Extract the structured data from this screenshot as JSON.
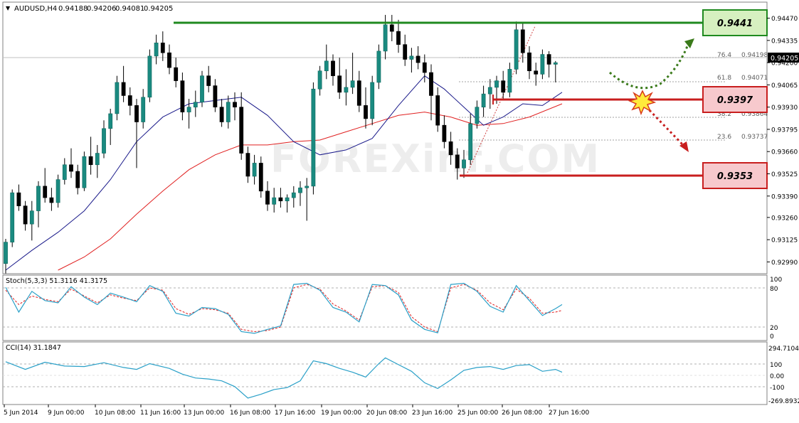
{
  "header": {
    "symbol_label": "AUDUSD,H4",
    "ohlc": [
      "0.94188",
      "0.94206",
      "0.94081",
      "0.94205"
    ]
  },
  "price_axis": {
    "ticks": [
      "0.94470",
      "0.94335",
      "0.94200",
      "0.94065",
      "0.93930",
      "0.93795",
      "0.93660",
      "0.93525",
      "0.93390",
      "0.93260",
      "0.93125",
      "0.92990"
    ],
    "current_price": "0.94205"
  },
  "time_axis": {
    "labels": [
      "5 Jun 2014",
      "9 Jun 00:00",
      "10 Jun 08:00",
      "11 Jun 16:00",
      "13 Jun 00:00",
      "16 Jun 08:00",
      "17 Jun 16:00",
      "19 Jun 00:00",
      "20 Jun 08:00",
      "23 Jun 16:00",
      "25 Jun 00:00",
      "26 Jun 08:00",
      "27 Jun 16:00"
    ]
  },
  "levels": [
    {
      "name": "resistance",
      "value": "0.9441",
      "color": "#1f8a1f",
      "fill": "#d6f0c0"
    },
    {
      "name": "pivot",
      "value": "0.9397",
      "color": "#c81e1e",
      "fill": "#f7c9cd"
    },
    {
      "name": "support",
      "value": "0.9353",
      "color": "#c81e1e",
      "fill": "#f7c9cd"
    }
  ],
  "fibonacci": [
    {
      "pct": "76.4",
      "price": "0.94198"
    },
    {
      "pct": "61.8",
      "price": "0.94071"
    },
    {
      "pct": "38.2",
      "price": "0.93864"
    },
    {
      "pct": "23.6",
      "price": "0.93737"
    }
  ],
  "watermark": "FOREXinf.COM",
  "stoch": {
    "label": "Stoch(5,3,3) 51.3116 41.3175",
    "ticks": [
      "100",
      "80",
      "20",
      "0"
    ]
  },
  "cci": {
    "label": "CCI(14) 31.1847",
    "ticks": [
      "294.7104",
      "100",
      "0.00",
      "-100",
      "-269.8932"
    ]
  },
  "chart_data": {
    "type": "candlestick",
    "symbol": "AUDUSD",
    "timeframe": "H4",
    "ylim": [
      0.9294,
      0.9452
    ],
    "candles": [
      [
        0.9298,
        0.9313,
        0.9292,
        0.9311
      ],
      [
        0.9311,
        0.9343,
        0.9308,
        0.9341
      ],
      [
        0.9341,
        0.9346,
        0.933,
        0.9333
      ],
      [
        0.9333,
        0.9336,
        0.9318,
        0.9322
      ],
      [
        0.9322,
        0.9336,
        0.9312,
        0.933
      ],
      [
        0.933,
        0.9348,
        0.932,
        0.9345
      ],
      [
        0.9345,
        0.9356,
        0.9335,
        0.9338
      ],
      [
        0.9338,
        0.9344,
        0.933,
        0.9335
      ],
      [
        0.9335,
        0.9352,
        0.9332,
        0.9349
      ],
      [
        0.9349,
        0.9362,
        0.9346,
        0.9358
      ],
      [
        0.9358,
        0.9368,
        0.935,
        0.9354
      ],
      [
        0.9354,
        0.9358,
        0.934,
        0.9344
      ],
      [
        0.9344,
        0.9366,
        0.9342,
        0.9363
      ],
      [
        0.9363,
        0.9375,
        0.9352,
        0.9358
      ],
      [
        0.9358,
        0.937,
        0.935,
        0.9365
      ],
      [
        0.9365,
        0.9385,
        0.9362,
        0.938
      ],
      [
        0.938,
        0.9392,
        0.937,
        0.9389
      ],
      [
        0.9389,
        0.9412,
        0.9385,
        0.9408
      ],
      [
        0.9408,
        0.9418,
        0.9396,
        0.94
      ],
      [
        0.94,
        0.9405,
        0.9388,
        0.9394
      ],
      [
        0.9394,
        0.9398,
        0.9356,
        0.9384
      ],
      [
        0.9384,
        0.9404,
        0.938,
        0.9399
      ],
      [
        0.9399,
        0.9428,
        0.9396,
        0.9424
      ],
      [
        0.9424,
        0.9437,
        0.9419,
        0.9432
      ],
      [
        0.9432,
        0.9439,
        0.9421,
        0.9426
      ],
      [
        0.9426,
        0.9431,
        0.9413,
        0.9417
      ],
      [
        0.9417,
        0.9423,
        0.9405,
        0.9409
      ],
      [
        0.9409,
        0.9414,
        0.9385,
        0.939
      ],
      [
        0.939,
        0.9398,
        0.938,
        0.9393
      ],
      [
        0.9393,
        0.9403,
        0.9387,
        0.9396
      ],
      [
        0.9396,
        0.9415,
        0.9393,
        0.9412
      ],
      [
        0.9412,
        0.9418,
        0.9402,
        0.9406
      ],
      [
        0.9406,
        0.941,
        0.939,
        0.9393
      ],
      [
        0.9393,
        0.9398,
        0.9381,
        0.9384
      ],
      [
        0.9384,
        0.94,
        0.938,
        0.9396
      ],
      [
        0.9396,
        0.9402,
        0.9385,
        0.9393
      ],
      [
        0.9393,
        0.9402,
        0.9361,
        0.9365
      ],
      [
        0.9365,
        0.9369,
        0.9347,
        0.9351
      ],
      [
        0.9351,
        0.9364,
        0.9346,
        0.9359
      ],
      [
        0.9359,
        0.9363,
        0.9338,
        0.9342
      ],
      [
        0.9342,
        0.9348,
        0.933,
        0.9334
      ],
      [
        0.9334,
        0.9344,
        0.9329,
        0.9338
      ],
      [
        0.9338,
        0.9344,
        0.9332,
        0.9336
      ],
      [
        0.9336,
        0.934,
        0.9329,
        0.9338
      ],
      [
        0.9338,
        0.9345,
        0.9332,
        0.9341
      ],
      [
        0.9341,
        0.9348,
        0.9333,
        0.9344
      ],
      [
        0.9344,
        0.935,
        0.9324,
        0.9345
      ],
      [
        0.9345,
        0.9408,
        0.934,
        0.9404
      ],
      [
        0.9404,
        0.9418,
        0.94,
        0.9415
      ],
      [
        0.9415,
        0.9431,
        0.941,
        0.9421
      ],
      [
        0.9421,
        0.9425,
        0.9406,
        0.9412
      ],
      [
        0.9412,
        0.9423,
        0.9398,
        0.9402
      ],
      [
        0.9402,
        0.9416,
        0.9394,
        0.9405
      ],
      [
        0.9405,
        0.9426,
        0.9401,
        0.9409
      ],
      [
        0.9409,
        0.9415,
        0.939,
        0.9394
      ],
      [
        0.9394,
        0.9405,
        0.938,
        0.9386
      ],
      [
        0.9386,
        0.9412,
        0.9382,
        0.9408
      ],
      [
        0.9408,
        0.9431,
        0.9404,
        0.9427
      ],
      [
        0.9427,
        0.9449,
        0.9422,
        0.9443
      ],
      [
        0.9443,
        0.9449,
        0.9433,
        0.9439
      ],
      [
        0.9439,
        0.9446,
        0.9426,
        0.9431
      ],
      [
        0.9431,
        0.9437,
        0.9418,
        0.9422
      ],
      [
        0.9422,
        0.9429,
        0.9414,
        0.9424
      ],
      [
        0.9424,
        0.943,
        0.9416,
        0.942
      ],
      [
        0.942,
        0.9425,
        0.9408,
        0.9414
      ],
      [
        0.9414,
        0.9419,
        0.9385,
        0.94
      ],
      [
        0.94,
        0.9405,
        0.9378,
        0.9382
      ],
      [
        0.9382,
        0.9388,
        0.9368,
        0.9372
      ],
      [
        0.9372,
        0.9378,
        0.9358,
        0.9364
      ],
      [
        0.9364,
        0.9368,
        0.9349,
        0.9356
      ],
      [
        0.9356,
        0.9367,
        0.935,
        0.9361
      ],
      [
        0.9361,
        0.9389,
        0.9358,
        0.9383
      ],
      [
        0.9383,
        0.9397,
        0.938,
        0.9393
      ],
      [
        0.9393,
        0.9406,
        0.9387,
        0.9401
      ],
      [
        0.9401,
        0.941,
        0.9392,
        0.9405
      ],
      [
        0.9405,
        0.9412,
        0.9395,
        0.9409
      ],
      [
        0.9409,
        0.9415,
        0.9398,
        0.9402
      ],
      [
        0.9402,
        0.942,
        0.9399,
        0.9416
      ],
      [
        0.9416,
        0.9445,
        0.9413,
        0.944
      ],
      [
        0.944,
        0.9444,
        0.942,
        0.9426
      ],
      [
        0.9426,
        0.943,
        0.941,
        0.9415
      ],
      [
        0.9415,
        0.942,
        0.9406,
        0.9413
      ],
      [
        0.9413,
        0.9428,
        0.941,
        0.9425
      ],
      [
        0.9425,
        0.9427,
        0.9411,
        0.9419
      ],
      [
        0.9419,
        0.9421,
        0.9408,
        0.942
      ]
    ],
    "sma_fast": [
      [
        0,
        0.9294
      ],
      [
        4,
        0.9306
      ],
      [
        8,
        0.9317
      ],
      [
        12,
        0.933
      ],
      [
        16,
        0.9349
      ],
      [
        20,
        0.9372
      ],
      [
        24,
        0.9387
      ],
      [
        28,
        0.9395
      ],
      [
        32,
        0.9397
      ],
      [
        36,
        0.9399
      ],
      [
        40,
        0.9388
      ],
      [
        44,
        0.9372
      ],
      [
        48,
        0.9364
      ],
      [
        52,
        0.9367
      ],
      [
        56,
        0.9374
      ],
      [
        60,
        0.9394
      ],
      [
        64,
        0.9412
      ],
      [
        67,
        0.9404
      ],
      [
        70,
        0.9393
      ],
      [
        73,
        0.9382
      ],
      [
        76,
        0.9387
      ],
      [
        79,
        0.9395
      ],
      [
        82,
        0.9394
      ],
      [
        85,
        0.9402
      ]
    ],
    "sma_slow": [
      [
        8,
        0.9294
      ],
      [
        12,
        0.9302
      ],
      [
        16,
        0.9313
      ],
      [
        20,
        0.9328
      ],
      [
        24,
        0.9342
      ],
      [
        28,
        0.9355
      ],
      [
        32,
        0.9364
      ],
      [
        36,
        0.937
      ],
      [
        40,
        0.937
      ],
      [
        44,
        0.9372
      ],
      [
        48,
        0.9373
      ],
      [
        52,
        0.9378
      ],
      [
        56,
        0.9383
      ],
      [
        60,
        0.9388
      ],
      [
        64,
        0.939
      ],
      [
        68,
        0.9387
      ],
      [
        72,
        0.9382
      ],
      [
        76,
        0.9383
      ],
      [
        80,
        0.9387
      ],
      [
        85,
        0.9395
      ]
    ],
    "stoch_main": [
      [
        0,
        85
      ],
      [
        2,
        42
      ],
      [
        4,
        78
      ],
      [
        6,
        62
      ],
      [
        8,
        58
      ],
      [
        10,
        86
      ],
      [
        12,
        68
      ],
      [
        14,
        55
      ],
      [
        16,
        75
      ],
      [
        18,
        68
      ],
      [
        20,
        60
      ],
      [
        22,
        88
      ],
      [
        24,
        78
      ],
      [
        26,
        40
      ],
      [
        28,
        35
      ],
      [
        30,
        50
      ],
      [
        32,
        48
      ],
      [
        34,
        38
      ],
      [
        36,
        8
      ],
      [
        38,
        5
      ],
      [
        40,
        12
      ],
      [
        42,
        18
      ],
      [
        44,
        90
      ],
      [
        46,
        92
      ],
      [
        48,
        80
      ],
      [
        50,
        50
      ],
      [
        52,
        42
      ],
      [
        54,
        25
      ],
      [
        56,
        90
      ],
      [
        58,
        88
      ],
      [
        60,
        72
      ],
      [
        62,
        28
      ],
      [
        64,
        12
      ],
      [
        66,
        6
      ],
      [
        68,
        90
      ],
      [
        70,
        92
      ],
      [
        72,
        78
      ],
      [
        74,
        52
      ],
      [
        76,
        42
      ],
      [
        78,
        88
      ],
      [
        80,
        62
      ],
      [
        82,
        36
      ],
      [
        84,
        48
      ],
      [
        85,
        55
      ]
    ],
    "stoch_signal": [
      [
        0,
        80
      ],
      [
        2,
        55
      ],
      [
        4,
        70
      ],
      [
        6,
        64
      ],
      [
        8,
        60
      ],
      [
        10,
        82
      ],
      [
        12,
        70
      ],
      [
        14,
        58
      ],
      [
        16,
        72
      ],
      [
        18,
        66
      ],
      [
        20,
        62
      ],
      [
        22,
        84
      ],
      [
        24,
        80
      ],
      [
        26,
        48
      ],
      [
        28,
        38
      ],
      [
        30,
        48
      ],
      [
        32,
        46
      ],
      [
        34,
        40
      ],
      [
        36,
        12
      ],
      [
        38,
        8
      ],
      [
        40,
        10
      ],
      [
        42,
        16
      ],
      [
        44,
        84
      ],
      [
        46,
        90
      ],
      [
        48,
        82
      ],
      [
        50,
        56
      ],
      [
        52,
        44
      ],
      [
        54,
        28
      ],
      [
        56,
        86
      ],
      [
        58,
        88
      ],
      [
        60,
        76
      ],
      [
        62,
        34
      ],
      [
        64,
        16
      ],
      [
        66,
        8
      ],
      [
        68,
        84
      ],
      [
        70,
        90
      ],
      [
        72,
        80
      ],
      [
        74,
        58
      ],
      [
        76,
        46
      ],
      [
        78,
        82
      ],
      [
        80,
        66
      ],
      [
        82,
        40
      ],
      [
        84,
        42
      ],
      [
        85,
        45
      ]
    ],
    "cci": [
      [
        0,
        140
      ],
      [
        3,
        60
      ],
      [
        6,
        135
      ],
      [
        9,
        95
      ],
      [
        12,
        90
      ],
      [
        15,
        130
      ],
      [
        18,
        80
      ],
      [
        20,
        60
      ],
      [
        22,
        120
      ],
      [
        25,
        70
      ],
      [
        27,
        10
      ],
      [
        29,
        -30
      ],
      [
        31,
        -40
      ],
      [
        33,
        -60
      ],
      [
        35,
        -120
      ],
      [
        37,
        -240
      ],
      [
        39,
        -200
      ],
      [
        41,
        -150
      ],
      [
        43,
        -130
      ],
      [
        45,
        -60
      ],
      [
        47,
        150
      ],
      [
        49,
        120
      ],
      [
        51,
        70
      ],
      [
        53,
        30
      ],
      [
        55,
        -20
      ],
      [
        57,
        120
      ],
      [
        58,
        180
      ],
      [
        60,
        110
      ],
      [
        62,
        40
      ],
      [
        64,
        -80
      ],
      [
        66,
        -140
      ],
      [
        68,
        -50
      ],
      [
        70,
        50
      ],
      [
        72,
        80
      ],
      [
        74,
        90
      ],
      [
        76,
        60
      ],
      [
        78,
        100
      ],
      [
        80,
        110
      ],
      [
        82,
        40
      ],
      [
        84,
        60
      ],
      [
        85,
        30
      ]
    ]
  }
}
